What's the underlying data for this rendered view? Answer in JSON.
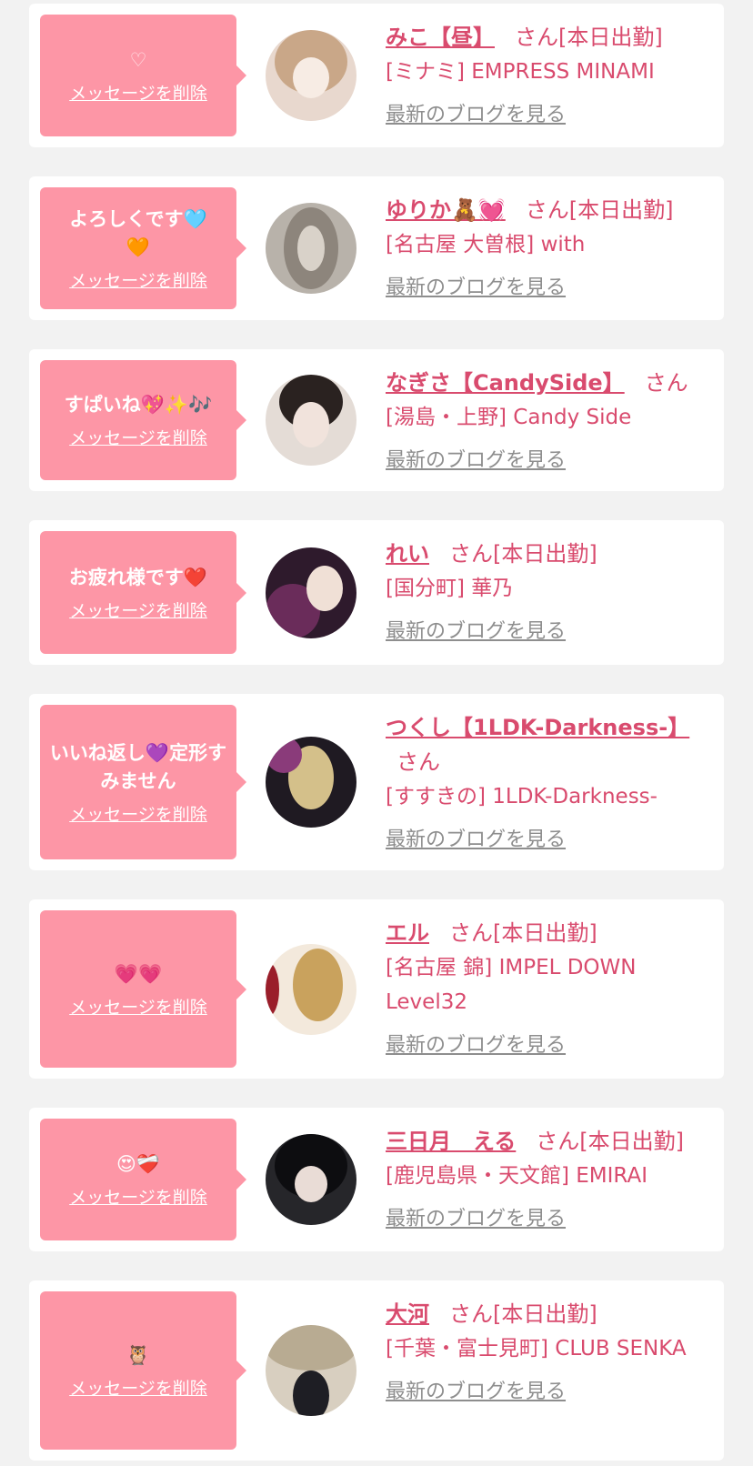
{
  "delete_label": "メッセージを削除",
  "blog_label": "最新のブログを見る",
  "honorific": "さん",
  "colors": {
    "page_bg": "#f2f2f2",
    "card_bg": "#ffffff",
    "bubble_bg": "#fd96a6",
    "accent_pink": "#d94b6e",
    "link_gray": "#8e8e8e"
  },
  "messages": [
    {
      "message": "♡",
      "name": "みこ【昼】",
      "status": "[本日出勤]",
      "shop": "[ミナミ] EMPRESS MINAMI",
      "avatar_icon": "profile-photo-icon"
    },
    {
      "message": "よろしくです🩵🧡",
      "name": "ゆりか🧸💓",
      "status": "[本日出勤]",
      "shop": "[名古屋 大曽根] with",
      "avatar_icon": "profile-photo-icon"
    },
    {
      "message": "すぱいね💖✨🎶",
      "name": "なぎさ【CandySide】",
      "status": "",
      "shop": "[湯島・上野] Candy Side",
      "avatar_icon": "profile-photo-icon"
    },
    {
      "message": "お疲れ様です❤️",
      "name": "れい",
      "status": "[本日出勤]",
      "shop": "[国分町] 華乃",
      "avatar_icon": "profile-photo-icon"
    },
    {
      "message": "いいね返し💜定形すみません",
      "name": "つくし【1LDK-Darkness-】",
      "status": "",
      "shop": "[すすきの] 1LDK-Darkness-",
      "avatar_icon": "profile-photo-icon"
    },
    {
      "message": "💗💗",
      "name": "エル",
      "status": "[本日出勤]",
      "shop": "[名古屋 錦] IMPEL DOWN Level32",
      "avatar_icon": "profile-photo-icon"
    },
    {
      "message": "😍❤️‍🩹",
      "name": "三日月　える",
      "status": "[本日出勤]",
      "shop": "[鹿児島県・天文館] EMIRAI",
      "avatar_icon": "profile-photo-icon"
    },
    {
      "message": "🦉",
      "name": "大河",
      "status": "[本日出勤]",
      "shop": "[千葉・富士見町] CLUB SENKA",
      "avatar_icon": "profile-photo-icon"
    }
  ]
}
